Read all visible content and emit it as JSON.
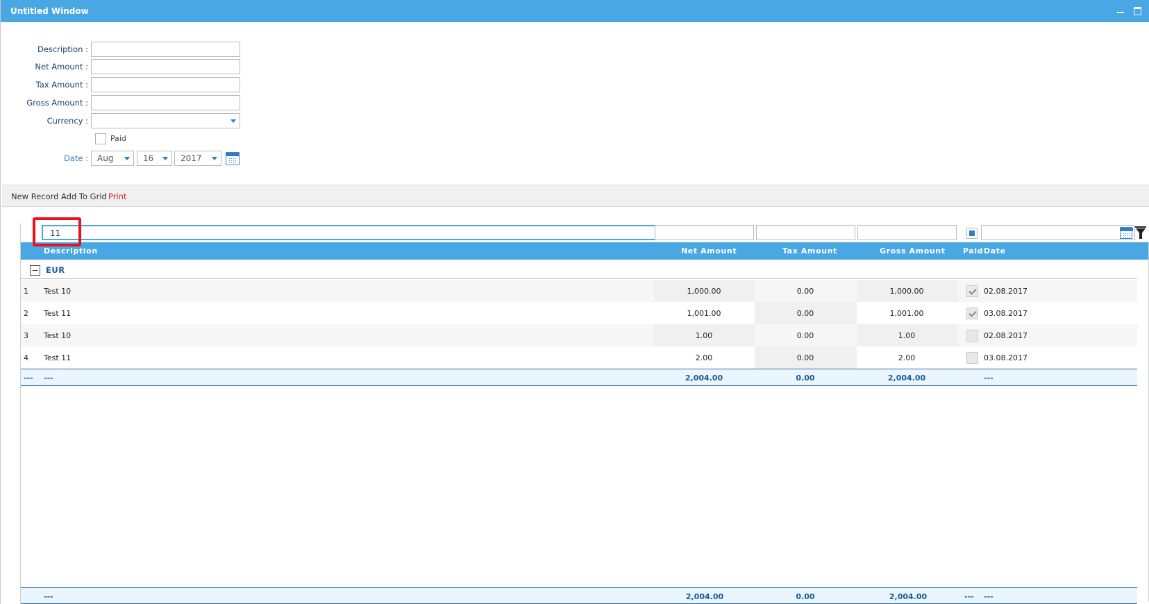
{
  "window": {
    "title": "Untitled Window"
  },
  "form": {
    "description_label": "Description :",
    "net_label": "Net Amount :",
    "tax_label": "Tax Amount :",
    "gross_label": "Gross Amount :",
    "currency_label": "Currency :",
    "paid_label": "Paid",
    "date_label": "Date :",
    "description_value": "",
    "net_value": "",
    "tax_value": "",
    "gross_value": "",
    "currency_value": "",
    "date_month": "Aug",
    "date_day": "16",
    "date_year": "2017"
  },
  "toolbar": {
    "new_record": "New Record",
    "add_to_grid": "Add To Grid",
    "print": "Print",
    "print_color": "#e02020"
  },
  "grid": {
    "filter_description": "11",
    "columns": {
      "description": "Description",
      "net": "Net Amount",
      "tax": "Tax Amount",
      "gross": "Gross Amount",
      "paid": "Paid",
      "date": "Date"
    },
    "group": "EUR",
    "rows": [
      {
        "idx": "1",
        "description": "Test 10",
        "net": "1,000.00",
        "tax": "0.00",
        "gross": "1,000.00",
        "paid": true,
        "date": "02.08.2017"
      },
      {
        "idx": "2",
        "description": "Test 11",
        "net": "1,001.00",
        "tax": "0.00",
        "gross": "1,001.00",
        "paid": true,
        "date": "03.08.2017"
      },
      {
        "idx": "3",
        "description": "Test 10",
        "net": "1.00",
        "tax": "0.00",
        "gross": "1.00",
        "paid": false,
        "date": "02.08.2017"
      },
      {
        "idx": "4",
        "description": "Test 11",
        "net": "2.00",
        "tax": "0.00",
        "gross": "2.00",
        "paid": false,
        "date": "03.08.2017"
      }
    ],
    "group_summary": {
      "idx": "---",
      "description": "---",
      "net": "2,004.00",
      "tax": "0.00",
      "gross": "2,004.00",
      "date": "---"
    },
    "total_summary": {
      "description": "---",
      "net": "2,004.00",
      "tax": "0.00",
      "gross": "2,004.00",
      "paid": "---",
      "date": "---"
    }
  },
  "colors": {
    "accent": "#49a7e3",
    "highlight_box": "#e8141c"
  },
  "icons": [
    "minimize-icon",
    "maximize-icon",
    "dropdown-caret-icon",
    "calendar-icon",
    "collapse-icon",
    "checkmark-icon",
    "filter-icon"
  ]
}
